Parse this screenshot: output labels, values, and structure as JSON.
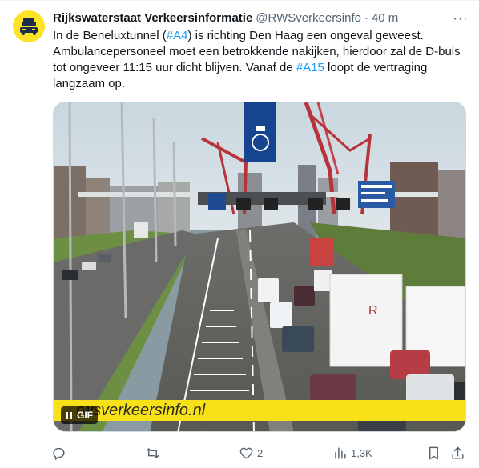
{
  "tweet": {
    "author_name": "Rijkswaterstaat Verkeersinformatie",
    "handle": "@RWSverkeersinfo",
    "separator": "·",
    "time": "40 m",
    "more": "···",
    "text_parts": {
      "p1": "In de Beneluxtunnel (",
      "tag1": "#A4",
      "p2": ") is richting Den Haag een ongeval geweest. Ambulancepersoneel moet een betrokkende nakijken, hierdoor zal de D-buis tot ongeveer 11:15 uur dicht blijven. Vanaf de ",
      "tag2": "#A15",
      "p3": " loopt de vertraging langzaam op."
    },
    "media": {
      "watermark": "rwsverkeersinfo.nl",
      "gif_label": "GIF",
      "sign_letter": "R"
    },
    "actions": {
      "reply_count": "",
      "retweet_count": "",
      "like_count": "2",
      "views_count": "1,3K"
    }
  },
  "colors": {
    "accent": "#1d9bf0",
    "muted": "#536471",
    "avatar_bg": "#fce229",
    "watermark_bar": "#f7e21a"
  },
  "icons": {
    "avatar": "rijkswaterstaat-car-logo-icon",
    "more": "more-horizontal-icon",
    "reply": "reply-icon",
    "retweet": "retweet-icon",
    "like": "heart-icon",
    "views": "views-chart-icon",
    "bookmark": "bookmark-icon",
    "share": "share-icon",
    "pause": "pause-icon"
  }
}
